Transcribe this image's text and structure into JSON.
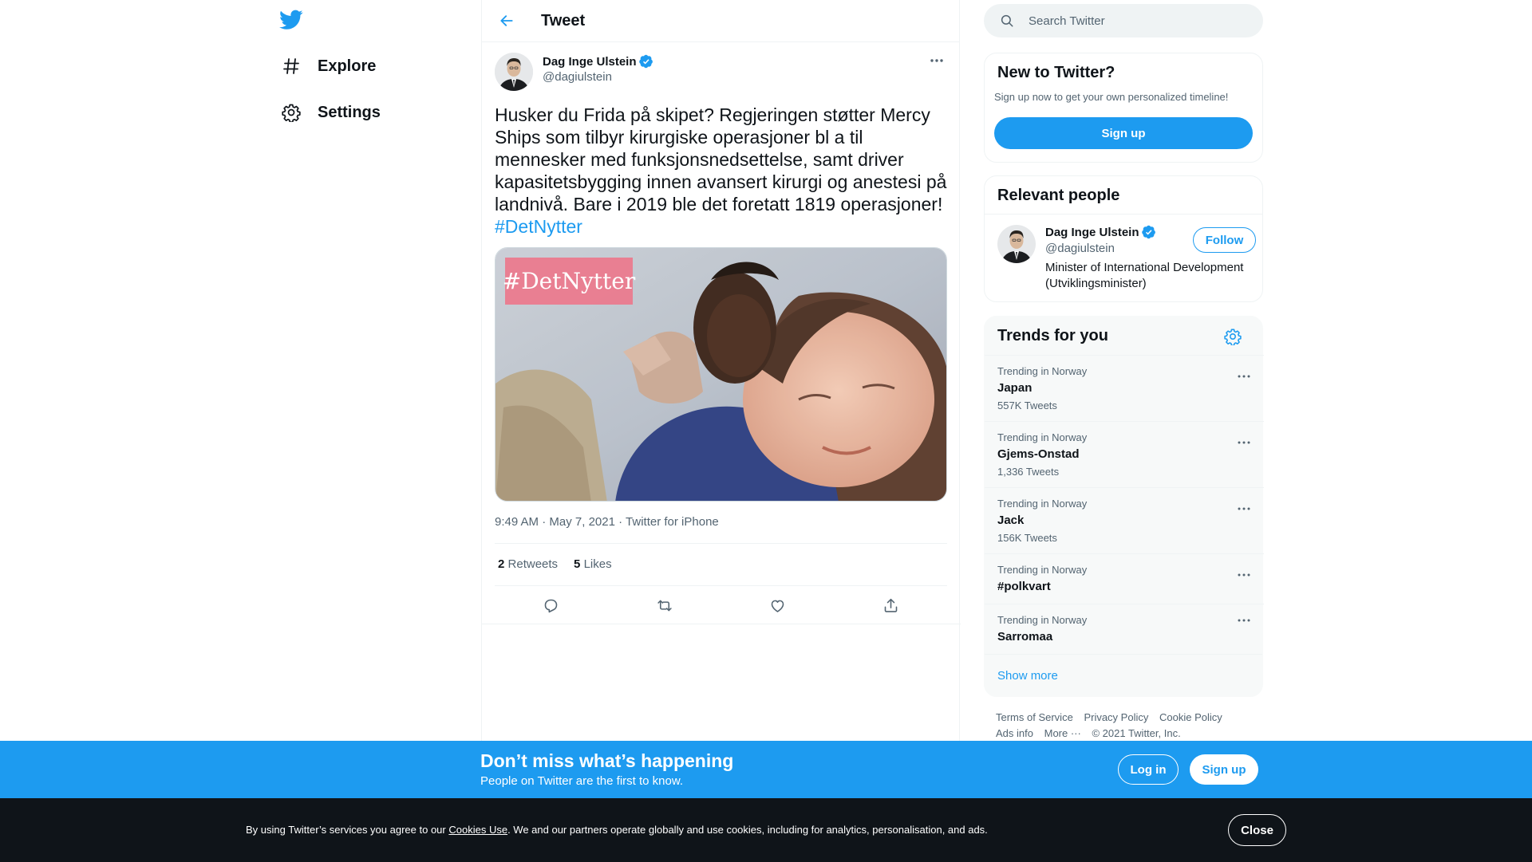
{
  "nav": {
    "items": [
      {
        "label": "Explore",
        "icon": "hashtag-icon"
      },
      {
        "label": "Settings",
        "icon": "gear-icon"
      }
    ]
  },
  "header": {
    "title": "Tweet"
  },
  "tweet": {
    "author_name": "Dag Inge Ulstein",
    "author_handle": "@dagiulstein",
    "text": "Husker du Frida på skipet? Regjeringen støtter Mercy Ships som tilbyr kirurgiske operasjoner bl a til mennesker med funksjonsnedsettelse, samt driver kapasitetsbygging innen avansert kirurgi og anestesi på landnivå. Bare i 2019 ble det foretatt 1819 operasjoner!",
    "hashtag": "#DetNytter",
    "media_tag": "#DetNytter",
    "time": "9:49 AM",
    "date": "May 7, 2021",
    "source": "Twitter for iPhone",
    "separator": "·",
    "retweets_count": "2",
    "retweets_label": "Retweets",
    "likes_count": "5",
    "likes_label": "Likes"
  },
  "search": {
    "placeholder": "Search Twitter"
  },
  "signup_card": {
    "title": "New to Twitter?",
    "subtitle": "Sign up now to get your own personalized timeline!",
    "button": "Sign up"
  },
  "relevant": {
    "title": "Relevant people",
    "name": "Dag Inge Ulstein",
    "handle": "@dagiulstein",
    "bio": "Minister of International Development (Utviklingsminister)",
    "follow": "Follow"
  },
  "trends": {
    "title": "Trends for you",
    "items": [
      {
        "location": "Trending in Norway",
        "name": "Japan",
        "count": "557K Tweets"
      },
      {
        "location": "Trending in Norway",
        "name": "Gjems-Onstad",
        "count": "1,336 Tweets"
      },
      {
        "location": "Trending in Norway",
        "name": "Jack",
        "count": "156K Tweets"
      },
      {
        "location": "Trending in Norway",
        "name": "#polkvart",
        "count": ""
      },
      {
        "location": "Trending in Norway",
        "name": "Sarromaa",
        "count": ""
      }
    ],
    "show_more": "Show more"
  },
  "footer": {
    "links": [
      "Terms of Service",
      "Privacy Policy",
      "Cookie Policy",
      "Ads info",
      "More ···"
    ],
    "copyright": "© 2021 Twitter, Inc."
  },
  "banner": {
    "title": "Don’t miss what’s happening",
    "subtitle": "People on Twitter are the first to know.",
    "login": "Log in",
    "signup": "Sign up"
  },
  "cookie": {
    "prefix": "By using Twitter’s services you agree to our ",
    "link": "Cookies Use",
    "suffix": ". We and our partners operate globally and use cookies, including for analytics, personalisation, and ads.",
    "close": "Close"
  },
  "colors": {
    "accent": "#1d9bf0",
    "text": "#0f1419",
    "muted": "#536471",
    "dark": "#0f1419"
  }
}
